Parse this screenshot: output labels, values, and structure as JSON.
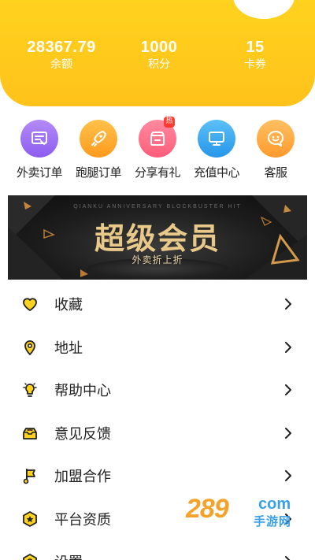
{
  "stats": [
    {
      "value": "28367.79",
      "label": "余额"
    },
    {
      "value": "1000",
      "label": "积分"
    },
    {
      "value": "15",
      "label": "卡券"
    }
  ],
  "quick_actions": [
    {
      "label": "外卖订单",
      "icon": "receipt-icon",
      "color": "#9b6df2"
    },
    {
      "label": "跑腿订单",
      "icon": "rocket-icon",
      "color": "#ffa826"
    },
    {
      "label": "分享有礼",
      "icon": "gift-shop-icon",
      "color": "#ff6f86",
      "badge": "热"
    },
    {
      "label": "充值中心",
      "icon": "monitor-icon",
      "color": "#2fa6f0"
    },
    {
      "label": "客服",
      "icon": "smile-chat-icon",
      "color": "#ffa33a"
    }
  ],
  "banner": {
    "subtitle": "QIANKU ANNIVERSARY BLOCKBUSTER HIT",
    "title": "超级会员",
    "tagline": "外卖折上折"
  },
  "menu": [
    {
      "label": "收藏",
      "icon": "heart-icon"
    },
    {
      "label": "地址",
      "icon": "location-icon"
    },
    {
      "label": "帮助中心",
      "icon": "lightbulb-icon"
    },
    {
      "label": "意见反馈",
      "icon": "feedback-box-icon"
    },
    {
      "label": "加盟合作",
      "icon": "flag-icon"
    },
    {
      "label": "平台资质",
      "icon": "badge-icon"
    },
    {
      "label": "设置",
      "icon": "gear-icon"
    }
  ],
  "watermark": {
    "number": "289",
    "suffix": "com",
    "text": "手游网"
  },
  "colors": {
    "accent": "#ffc21a",
    "icon_yellow": "#ffd21e",
    "text": "#222222"
  }
}
